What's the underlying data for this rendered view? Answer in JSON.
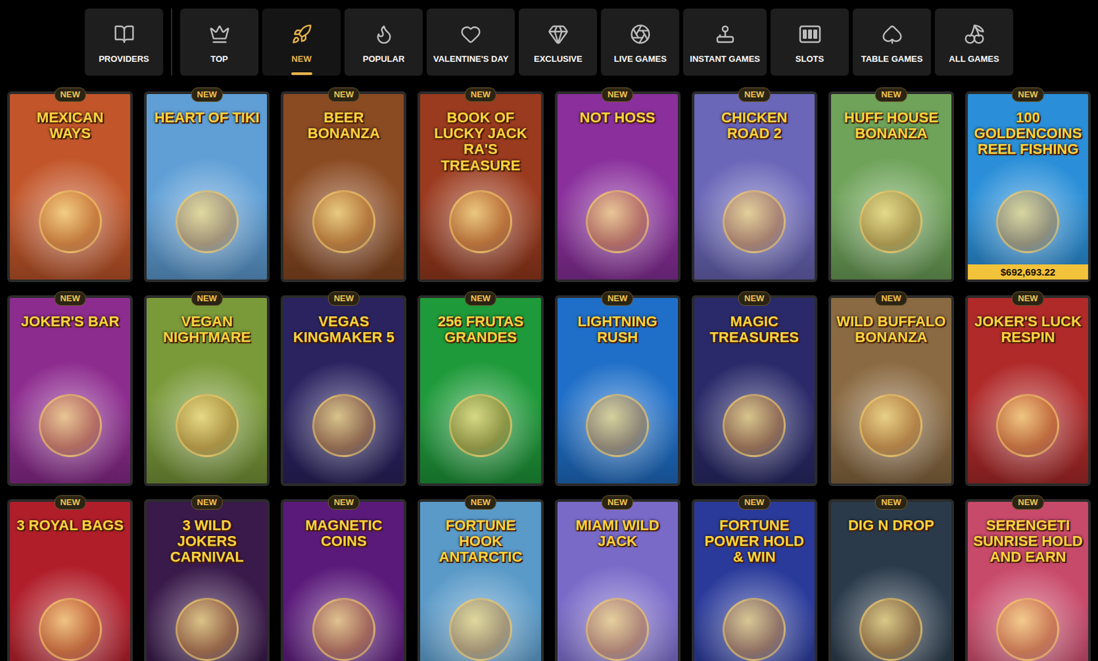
{
  "providers": {
    "label": "PROVIDERS"
  },
  "tabs": [
    {
      "label": "TOP",
      "selected": false
    },
    {
      "label": "NEW",
      "selected": true
    },
    {
      "label": "POPULAR",
      "selected": false
    },
    {
      "label": "VALENTINE'S DAY",
      "selected": false
    },
    {
      "label": "EXCLUSIVE",
      "selected": false
    },
    {
      "label": "LIVE GAMES",
      "selected": false
    },
    {
      "label": "INSTANT GAMES",
      "selected": false
    },
    {
      "label": "SLOTS",
      "selected": false
    },
    {
      "label": "TABLE GAMES",
      "selected": false
    },
    {
      "label": "ALL GAMES",
      "selected": false
    }
  ],
  "games": [
    {
      "title": "MEXICAN WAYS",
      "badge": "NEW",
      "color": "#c2562a"
    },
    {
      "title": "HEART OF TIKI",
      "badge": "NEW",
      "color": "#5f9fd6"
    },
    {
      "title": "BEER BONANZA",
      "badge": "NEW",
      "color": "#8a4a22"
    },
    {
      "title": "BOOK OF LUCKY JACK RA'S TREASURE",
      "badge": "NEW",
      "color": "#9a3a1e"
    },
    {
      "title": "NOT HOSS",
      "badge": "NEW",
      "color": "#8a2f9c"
    },
    {
      "title": "CHICKEN ROAD 2",
      "badge": "NEW",
      "color": "#6a66b8"
    },
    {
      "title": "HUFF HOUSE BONANZA",
      "badge": "NEW",
      "color": "#6fa35a"
    },
    {
      "title": "100 GOLDENCOINS REEL FISHING",
      "badge": "NEW",
      "color": "#2a8fd8",
      "jackpot": "$692,693.22"
    },
    {
      "title": "JOKER'S BAR",
      "badge": "NEW",
      "color": "#8d2c8f"
    },
    {
      "title": "VEGAN NIGHTMARE",
      "badge": "NEW",
      "color": "#7a9a3a"
    },
    {
      "title": "VEGAS KINGMAKER 5",
      "badge": "NEW",
      "color": "#2a2360"
    },
    {
      "title": "256 FRUTAS GRANDES",
      "badge": "NEW",
      "color": "#1f9a3a"
    },
    {
      "title": "LIGHTNING RUSH",
      "badge": "NEW",
      "color": "#1f6fc8"
    },
    {
      "title": "MAGIC TREASURES",
      "badge": "NEW",
      "color": "#2a2a6a"
    },
    {
      "title": "WILD BUFFALO BONANZA",
      "badge": "NEW",
      "color": "#8a6a42"
    },
    {
      "title": "JOKER'S LUCK RESPIN",
      "badge": "NEW",
      "color": "#b02a2a"
    },
    {
      "title": "3 ROYAL BAGS",
      "badge": "NEW",
      "color": "#b01e2a"
    },
    {
      "title": "3 WILD JOKERS CARNIVAL",
      "badge": "NEW",
      "color": "#3a1a4a"
    },
    {
      "title": "MAGNETIC COINS",
      "badge": "NEW",
      "color": "#5a1a7a"
    },
    {
      "title": "FORTUNE HOOK ANTARCTIC",
      "badge": "NEW",
      "color": "#5a9ac8"
    },
    {
      "title": "MIAMI WILD JACK",
      "badge": "NEW",
      "color": "#7a6ac8"
    },
    {
      "title": "FORTUNE POWER HOLD & WIN",
      "badge": "NEW",
      "color": "#2a3a9a"
    },
    {
      "title": "DIG N DROP",
      "badge": "NEW",
      "color": "#2a3a4a"
    },
    {
      "title": "SERENGETI SUNRISE HOLD AND EARN",
      "badge": "NEW",
      "color": "#c84a6a"
    }
  ]
}
